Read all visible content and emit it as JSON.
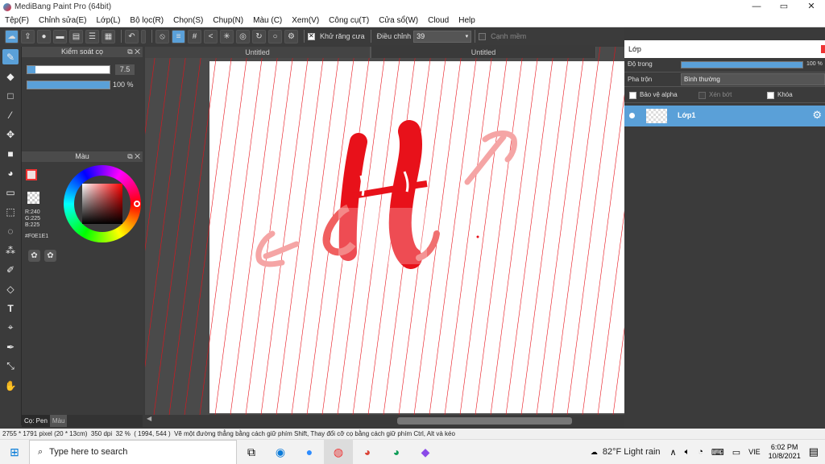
{
  "window": {
    "title": "MediBang Paint Pro (64bit)",
    "min": "—",
    "max": "▭",
    "close": "✕"
  },
  "menu": [
    "Tệp(F)",
    "Chỉnh sửa(E)",
    "Lớp(L)",
    "Bộ lọc(R)",
    "Chọn(S)",
    "Chụp(N)",
    "Màu (C)",
    "Xem(V)",
    "Công cụ(T)",
    "Cửa sổ(W)",
    "Cloud",
    "Help"
  ],
  "toolbar": {
    "antialias_label": "Khử răng cưa",
    "adjust_label": "Điều chỉnh",
    "adjust_value": "39",
    "sharp_label": "Cạnh mềm"
  },
  "brush_panel": {
    "title": "Kiểm soát cọ",
    "size": "7.5",
    "opacity": "100 %",
    "opacity_fraction": 1.0,
    "size_fraction": 0.1
  },
  "color_panel": {
    "title": "Màu",
    "r": "R:240",
    "g": "G:225",
    "b": "B:225",
    "hex": "#F0E1E1",
    "fg_color": "#F0E1E1"
  },
  "tabs": [
    "Untitled",
    "Untitled"
  ],
  "layer_panel": {
    "title": "Lớp",
    "opacity_label": "Độ trong",
    "opacity_value": "100 %",
    "blend_label": "Pha trộn",
    "blend_value": "Bình thường",
    "protect_alpha": "Bảo vệ alpha",
    "clip": "Xén bớt",
    "lock": "Khóa",
    "layer_name": "Lớp1"
  },
  "bottom_tabs": {
    "pen": "Cọ: Pen",
    "color": "Màu"
  },
  "status": {
    "size": "2755 * 1791 pixel",
    "dims": "(20 * 13cm)",
    "dpi": "350 dpi",
    "zoom": "32 %",
    "coords": "( 1994, 544 )",
    "hint": "Vẽ một đường thẳng bằng cách giữ phím Shift, Thay đổi cỡ cọ bằng cách giữ phím Ctrl, Alt và kéo"
  },
  "taskbar": {
    "search_placeholder": "Type here to search",
    "weather": "82°F  Light rain",
    "lang": "VIE",
    "time": "6:02 PM",
    "date": "10/8/2021"
  },
  "colors": {
    "accent": "#5aa0d8",
    "stroke_red": "#e8111a",
    "stroke_pink": "#f09090"
  }
}
